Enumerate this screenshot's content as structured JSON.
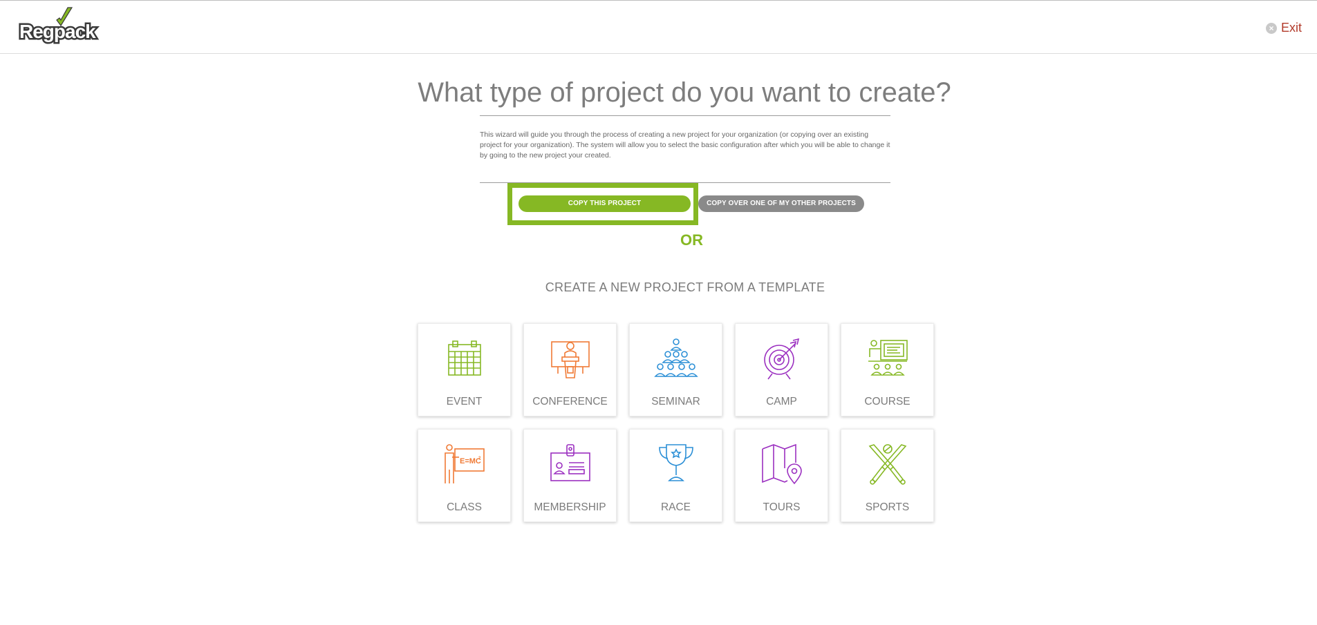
{
  "header": {
    "logo_text": "Regpack",
    "exit_label": "Exit"
  },
  "main": {
    "title": "What type of project do you want to create?",
    "intro": "This wizard will guide you through the process of creating a new project for your organization (or copying over an existing project for your organization). The system will allow you to select the basic configuration after which you will be able to change it by going to the new project your created.",
    "copy_button": "COPY THIS PROJECT",
    "copy_other_button": "COPY OVER ONE OF MY OTHER PROJECTS",
    "or_text": "OR",
    "template_heading": "CREATE A NEW PROJECT FROM A TEMPLATE"
  },
  "templates": [
    {
      "label": "EVENT",
      "icon": "calendar-icon",
      "color": "#86b824"
    },
    {
      "label": "CONFERENCE",
      "icon": "podium-icon",
      "color": "#f07a35"
    },
    {
      "label": "SEMINAR",
      "icon": "audience-icon",
      "color": "#2b8fd6"
    },
    {
      "label": "CAMP",
      "icon": "target-icon",
      "color": "#9b2fc0"
    },
    {
      "label": "COURSE",
      "icon": "teacher-board-icon",
      "color": "#86b824"
    },
    {
      "label": "CLASS",
      "icon": "class-board-icon",
      "color": "#f07a35"
    },
    {
      "label": "MEMBERSHIP",
      "icon": "id-card-icon",
      "color": "#9b2fc0"
    },
    {
      "label": "RACE",
      "icon": "trophy-icon",
      "color": "#2b8fd6"
    },
    {
      "label": "TOURS",
      "icon": "map-pin-icon",
      "color": "#9b2fc0"
    },
    {
      "label": "SPORTS",
      "icon": "crossed-bats-icon",
      "color": "#86b824"
    }
  ],
  "colors": {
    "accent": "#86b824",
    "secondary_button": "#8a8a8a",
    "exit": "#b23a2a"
  }
}
